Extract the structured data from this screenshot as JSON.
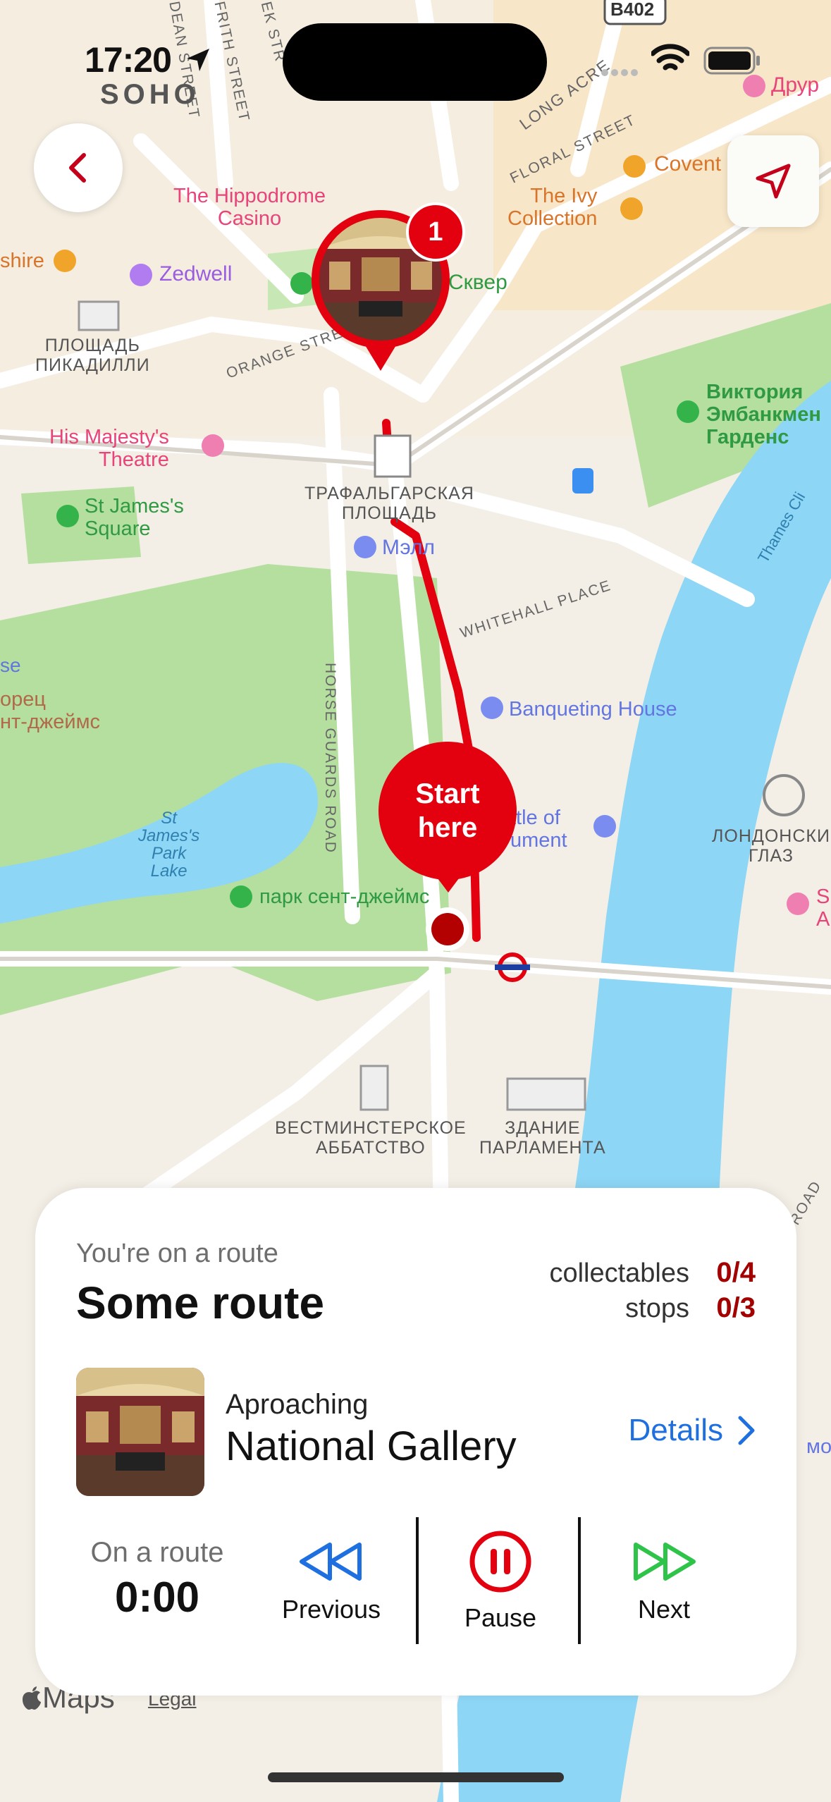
{
  "status_bar": {
    "time": "17:20",
    "location_label": "SOHO"
  },
  "map": {
    "labels": {
      "b402": "B402",
      "hippodrome": "The Hippodrome\nCasino",
      "ivy": "The Ivy\nCollection",
      "covent": "Covent",
      "drury": "Друр",
      "zedwell": "Zedwell",
      "skver": "Сквер",
      "shire": "shire",
      "piccadilly": "ПЛОЩАДЬ\nПИКАДИЛЛИ",
      "orange_street": "ORANGE STREE",
      "long_acre": "LONG ACRE",
      "floral_street": "FLORAL STREET",
      "dean_street": "DEAN STREET",
      "frith_street": "FRITH STREET",
      "greek_street": "EK STR",
      "victoria_gardens": "Виктория\nЭмбанкмен\nГарденс",
      "his_majestys": "His Majesty's\nTheatre",
      "st_james_square": "St James's\nSquare",
      "trafalgar": "ТРАФАЛЬГАРСКАЯ\nПЛОЩАДЬ",
      "mall": "Мэлл",
      "whitehall": "WHITEHALL PLACE",
      "thames_clipper": "Thames Cli",
      "se": "se",
      "palace": "орец\nнт-джеймс",
      "horse_guards": "HORSE GUARDS ROAD",
      "banqueting": "Banqueting House",
      "battle": "ttle of\nument",
      "london_eye": "ЛОНДОНСКИ\nГЛАЗ",
      "st_james_lake": "St\nJames's\nPark\nLake",
      "st_james_park": "парк сент-джеймс",
      "westminster_abbey": "ВЕСТМИНСТЕРСКОЕ\nАББАТСТВО",
      "parliament": "ЗДАНИЕ\nПАРЛАМЕНТА",
      "s_a": "S\nA",
      "maps": "Maps",
      "legal": "Legal",
      "road": "ROAD",
      "mo": "мо"
    },
    "gallery_pin_badge": "1",
    "start_pin": {
      "line1": "Start",
      "line2": "here"
    }
  },
  "route_panel": {
    "subtitle": "You're on a route",
    "route_name": "Some route",
    "stats": {
      "collectables_label": "collectables",
      "collectables_value": "0/4",
      "stops_label": "stops",
      "stops_value": "0/3"
    },
    "current_stop": {
      "status": "Aproaching",
      "name": "National Gallery",
      "details_label": "Details"
    },
    "timer": {
      "label": "On a route",
      "value": "0:00"
    },
    "controls": {
      "previous_label": "Previous",
      "pause_label": "Pause",
      "next_label": "Next"
    }
  },
  "colors": {
    "accent_red": "#e3000f",
    "dark_red": "#a30000",
    "link_blue": "#1e6fe0",
    "previous_blue": "#1e6fe0",
    "next_green": "#2ec44a",
    "water": "#8dd6f5",
    "park": "#b5df9f"
  },
  "icons": {
    "back": "chevron-left-icon",
    "locate": "navigation-arrow-icon",
    "previous": "rewind-icon",
    "pause": "pause-circle-icon",
    "next": "fast-forward-icon",
    "details": "chevron-right-icon"
  }
}
